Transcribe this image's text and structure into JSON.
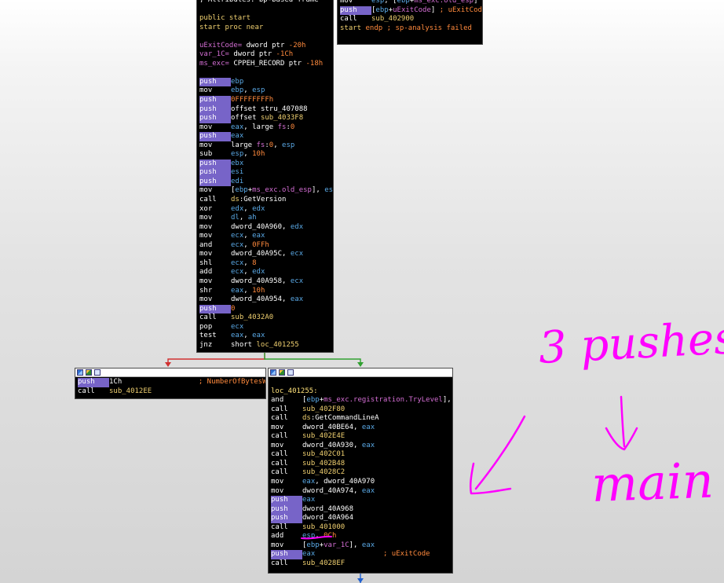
{
  "top_node": {
    "lines": [
      {
        "t": "; Attributes: bp-based frame"
      },
      {
        "t": ""
      },
      {
        "t": "public start"
      },
      {
        "t": "start proc near"
      },
      {
        "t": ""
      },
      {
        "t": "uExitCode= dword ptr -20h"
      },
      {
        "t": "var_1C= dword ptr -1Ch"
      },
      {
        "t": "ms_exc= CPPEH_RECORD ptr -18h"
      },
      {
        "t": ""
      },
      {
        "m": "push",
        "o": "ebp",
        "hl": true
      },
      {
        "m": "mov",
        "o": "ebp, esp"
      },
      {
        "m": "push",
        "o": "0FFFFFFFFh",
        "hl": true
      },
      {
        "m": "push",
        "o": "offset stru_407088",
        "hl": true
      },
      {
        "m": "push",
        "o": "offset sub_4033F8",
        "hl": true
      },
      {
        "m": "mov",
        "o": "eax, large fs:0"
      },
      {
        "m": "push",
        "o": "eax",
        "hl": true
      },
      {
        "m": "mov",
        "o": "large fs:0, esp"
      },
      {
        "m": "sub",
        "o": "esp, 10h"
      },
      {
        "m": "push",
        "o": "ebx",
        "hl": true
      },
      {
        "m": "push",
        "o": "esi",
        "hl": true
      },
      {
        "m": "push",
        "o": "edi",
        "hl": true
      },
      {
        "m": "mov",
        "o": "[ebp+ms_exc.old_esp], esp"
      },
      {
        "m": "call",
        "o": "ds:GetVersion"
      },
      {
        "m": "xor",
        "o": "edx, edx"
      },
      {
        "m": "mov",
        "o": "dl, ah"
      },
      {
        "m": "mov",
        "o": "dword_40A960, edx"
      },
      {
        "m": "mov",
        "o": "ecx, eax"
      },
      {
        "m": "and",
        "o": "ecx, 0FFh"
      },
      {
        "m": "mov",
        "o": "dword_40A95C, ecx"
      },
      {
        "m": "shl",
        "o": "ecx, 8"
      },
      {
        "m": "add",
        "o": "ecx, edx"
      },
      {
        "m": "mov",
        "o": "dword_40A958, ecx"
      },
      {
        "m": "shr",
        "o": "eax, 10h"
      },
      {
        "m": "mov",
        "o": "dword_40A954, eax"
      },
      {
        "m": "push",
        "o": "0",
        "hl": true
      },
      {
        "m": "call",
        "o": "sub_4032A0"
      },
      {
        "m": "pop",
        "o": "ecx"
      },
      {
        "m": "test",
        "o": "eax, eax"
      },
      {
        "m": "jnz",
        "o": "short loc_401255"
      }
    ]
  },
  "exit_node": {
    "lines": [
      {
        "m": "mov",
        "o": "esp, [ebp+ms_exc.old_esp]"
      },
      {
        "m": "push",
        "o": "[ebp+uExitCode] ; uExitCode",
        "hl": true
      },
      {
        "m": "call",
        "o": "sub_402900"
      },
      {
        "t": "start endp ; sp-analysis failed"
      }
    ]
  },
  "left_node": {
    "lines": [
      {
        "m": "push",
        "o": "1Ch                  ; NumberOfBytesWritten",
        "hl": true
      },
      {
        "m": "call",
        "o": "sub_4012EE"
      }
    ]
  },
  "right_node": {
    "lines": [
      {
        "t": ""
      },
      {
        "t": "loc_401255:"
      },
      {
        "m": "and",
        "o": "[ebp+ms_exc.registration.TryLevel], 0"
      },
      {
        "m": "call",
        "o": "sub_402F80"
      },
      {
        "m": "call",
        "o": "ds:GetCommandLineA"
      },
      {
        "m": "mov",
        "o": "dword_40BE64, eax"
      },
      {
        "m": "call",
        "o": "sub_402E4E"
      },
      {
        "m": "mov",
        "o": "dword_40A930, eax"
      },
      {
        "m": "call",
        "o": "sub_402C01"
      },
      {
        "m": "call",
        "o": "sub_402B48"
      },
      {
        "m": "call",
        "o": "sub_4028C2"
      },
      {
        "m": "mov",
        "o": "eax, dword_40A970"
      },
      {
        "m": "mov",
        "o": "dword_40A974, eax"
      },
      {
        "m": "push",
        "o": "eax",
        "hl": true
      },
      {
        "m": "push",
        "o": "dword_40A968",
        "hl": true
      },
      {
        "m": "push",
        "o": "dword_40A964",
        "hl": true
      },
      {
        "m": "call",
        "o": "sub_401000"
      },
      {
        "m": "add",
        "o": "esp, 0Ch"
      },
      {
        "m": "mov",
        "o": "[ebp+var_1C], eax"
      },
      {
        "m": "push",
        "o": "eax                ; uExitCode",
        "hl": true
      },
      {
        "m": "call",
        "o": "sub_4028EF"
      }
    ]
  },
  "annotations": {
    "note1": "3 pushes",
    "note2": "main",
    "ink_color": "#ff00ff"
  },
  "edge_colors": {
    "false_branch": "#d03030",
    "true_branch": "#30a030",
    "down": "#2060d0"
  }
}
